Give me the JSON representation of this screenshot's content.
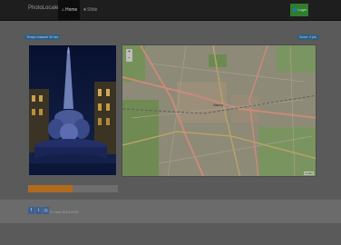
{
  "navbar": {
    "brand": "PhotoLocale",
    "items": [
      {
        "label": "Home",
        "icon": "home-icon",
        "glyph": "⌂",
        "active": true
      },
      {
        "label": "Sfide",
        "icon": "star-icon",
        "glyph": "★",
        "active": false
      }
    ],
    "login_label": "Login",
    "login_icon_glyph": "👤"
  },
  "labels": {
    "time_left": "Tempo restante 00 sec",
    "user_right": "Score: 0 pts"
  },
  "map": {
    "zoom_in": "+",
    "zoom_out": "−",
    "city": "Nancy",
    "attribution": "Leaflet"
  },
  "progress": {
    "value": 0.49,
    "color": "#b06a1f"
  },
  "footer": {
    "social": [
      {
        "icon": "facebook-icon",
        "glyph": "f"
      },
      {
        "icon": "twitter-icon",
        "glyph": "t"
      },
      {
        "icon": "instagram-icon",
        "glyph": "◎"
      }
    ],
    "copyright": "© Loue 2014-2015"
  }
}
